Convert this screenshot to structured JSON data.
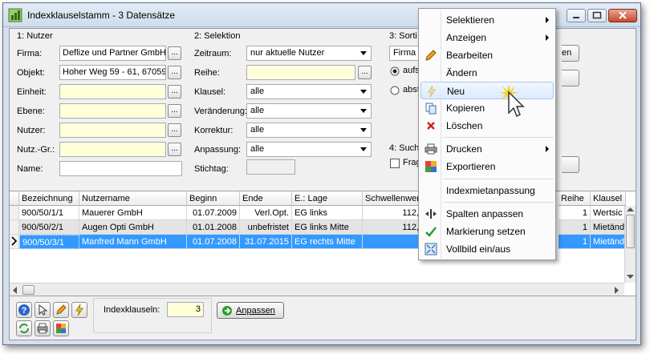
{
  "window": {
    "title": "Indexklauselstamm - 3 Datensätze"
  },
  "group_nutzer": {
    "title": "1: Nutzer",
    "fields": [
      {
        "label": "Firma:",
        "value": "Deflize und Partner GmbH"
      },
      {
        "label": "Objekt:",
        "value": "Hoher Weg 59 - 61, 67059"
      },
      {
        "label": "Einheit:",
        "value": ""
      },
      {
        "label": "Ebene:",
        "value": ""
      },
      {
        "label": "Nutzer:",
        "value": ""
      },
      {
        "label": "Nutz.-Gr.:",
        "value": ""
      }
    ],
    "name_label": "Name:",
    "name_value": "",
    "browse_label": "..."
  },
  "group_selektion": {
    "title": "2: Selektion",
    "zeitraum_label": "Zeitraum:",
    "zeitraum_value": "nur aktuelle Nutzer",
    "reihe_label": "Reihe:",
    "reihe_value": "",
    "klausel_label": "Klausel:",
    "klausel_value": "alle",
    "veraenderung_label": "Veränderung:",
    "veraenderung_value": "alle",
    "korrektur_label": "Korrektur:",
    "korrektur_value": "alle",
    "anpassung_label": "Anpassung:",
    "anpassung_value": "alle",
    "stichtag_label": "Stichtag:",
    "stichtag_value": ""
  },
  "group_sortierung": {
    "title": "3: Sorti",
    "combo_value": "Firma",
    "radio1": "aufst",
    "radio2": "abste",
    "button_partial": "en"
  },
  "group_suche": {
    "title": "4: Such",
    "checkbox_label": "Frag"
  },
  "grid": {
    "columns": [
      "Bezeichnung",
      "Nutzername",
      "Beginn",
      "Ende",
      "E.: Lage",
      "Schwellenwert",
      "Reihe",
      "Klausel"
    ],
    "rows": [
      {
        "bez": "900/50/1/1",
        "name": "Mauerer GmbH",
        "beginn": "01.07.2009",
        "ende": "Verl.Opt.",
        "lage": "EG links",
        "schwelle": "112,",
        "reihe": "1",
        "klausel": "Wertsic"
      },
      {
        "bez": "900/50/2/1",
        "name": "Augen Opti GmbH",
        "beginn": "01.01.2008",
        "ende": "unbefristet",
        "lage": "EG links Mitte",
        "schwelle": "112,",
        "reihe": "1",
        "klausel": "Mietänd"
      },
      {
        "bez": "900/50/3/1",
        "name": "Manfred Mann GmbH",
        "beginn": "01.07.2008",
        "ende": "31.07.2015",
        "lage": "EG rechts Mitte",
        "schwelle": "",
        "reihe": "1",
        "klausel": "Mietänd"
      }
    ]
  },
  "footer": {
    "count_label": "Indexklauseln:",
    "count_value": "3",
    "anpassen_label": "Anpassen"
  },
  "context_menu": {
    "items": [
      {
        "label": "Selektieren",
        "submenu": true
      },
      {
        "label": "Anzeigen",
        "submenu": true
      },
      {
        "label": "Bearbeiten"
      },
      {
        "label": "Ändern"
      },
      {
        "label": "Neu"
      },
      {
        "label": "Kopieren"
      },
      {
        "label": "Löschen"
      },
      {
        "label": "Drucken",
        "submenu": true
      },
      {
        "label": "Exportieren"
      },
      {
        "label": "Indexmietanpassung"
      },
      {
        "label": "Spalten anpassen"
      },
      {
        "label": "Markierung setzen"
      },
      {
        "label": "Vollbild ein/aus"
      }
    ]
  },
  "colors": {
    "selection": "#3399ff",
    "field_yellow": "#ffffd9",
    "menu_highlight": "#dbeafc"
  }
}
